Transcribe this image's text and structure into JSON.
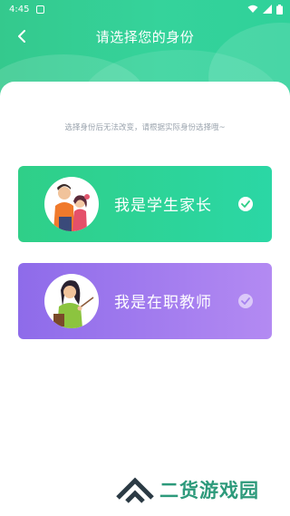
{
  "status_bar": {
    "time": "4:45"
  },
  "header": {
    "title": "请选择您的身份"
  },
  "hint": "选择身份后无法改变，请根据实际身份选择哦~",
  "options": [
    {
      "label": "我是学生家长",
      "selected": true
    },
    {
      "label": "我是在职教师",
      "selected": false
    }
  ],
  "watermark": {
    "text": "二货游戏园"
  },
  "colors": {
    "header": "#34c98d",
    "parent_card": "#2fcf88",
    "teacher_card": "#9d78ee"
  }
}
